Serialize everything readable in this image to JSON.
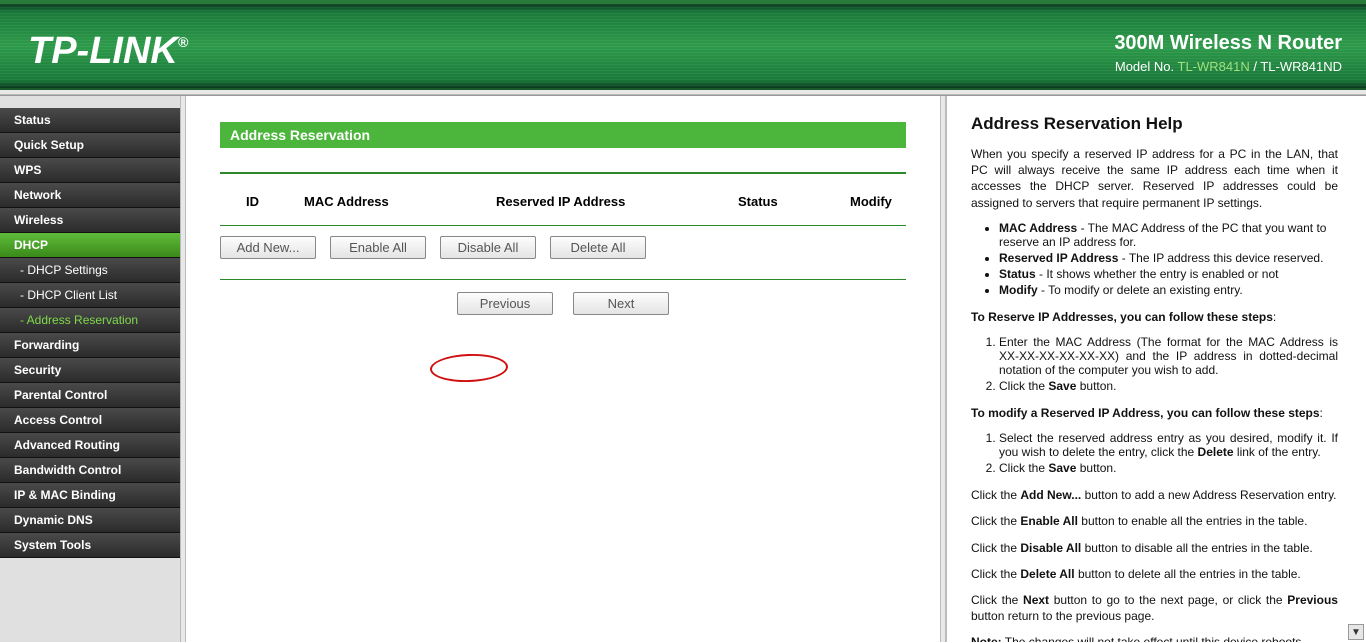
{
  "header": {
    "brand": "TP-LINK",
    "reg": "®",
    "product": "300M Wireless N Router",
    "model_prefix": "Model No. ",
    "model_hl": "TL-WR841N",
    "model_suffix": " / TL-WR841ND"
  },
  "sidebar": {
    "items": [
      {
        "label": "Status",
        "type": "top"
      },
      {
        "label": "Quick Setup",
        "type": "top"
      },
      {
        "label": "WPS",
        "type": "top"
      },
      {
        "label": "Network",
        "type": "top"
      },
      {
        "label": "Wireless",
        "type": "top"
      },
      {
        "label": "DHCP",
        "type": "section-active"
      },
      {
        "label": "- DHCP Settings",
        "type": "sub"
      },
      {
        "label": "- DHCP Client List",
        "type": "sub"
      },
      {
        "label": "- Address Reservation",
        "type": "sub active"
      },
      {
        "label": "Forwarding",
        "type": "top"
      },
      {
        "label": "Security",
        "type": "top"
      },
      {
        "label": "Parental Control",
        "type": "top"
      },
      {
        "label": "Access Control",
        "type": "top"
      },
      {
        "label": "Advanced Routing",
        "type": "top"
      },
      {
        "label": "Bandwidth Control",
        "type": "top"
      },
      {
        "label": "IP & MAC Binding",
        "type": "top"
      },
      {
        "label": "Dynamic DNS",
        "type": "top"
      },
      {
        "label": "System Tools",
        "type": "top"
      }
    ]
  },
  "main": {
    "title": "Address Reservation",
    "columns": {
      "id": "ID",
      "mac": "MAC Address",
      "ip": "Reserved IP Address",
      "status": "Status",
      "modify": "Modify"
    },
    "buttons": {
      "add": "Add New...",
      "enable": "Enable All",
      "disable": "Disable All",
      "delete": "Delete All"
    },
    "pager": {
      "prev": "Previous",
      "next": "Next"
    }
  },
  "help": {
    "title": "Address Reservation Help",
    "intro": "When you specify a reserved IP address for a PC in the LAN, that PC will always receive the same IP address each time when it accesses the DHCP server. Reserved IP addresses could be assigned to servers that require permanent IP settings.",
    "defs": {
      "mac_t": "MAC Address",
      "mac_d": " - The MAC Address of the PC that you want to reserve an IP address for.",
      "rip_t": "Reserved IP Address",
      "rip_d": " - The IP address this device reserved.",
      "st_t": "Status",
      "st_d": " - It shows whether the entry is enabled or not",
      "mod_t": "Modify",
      "mod_d": " - To modify or delete an existing entry."
    },
    "steps1_title": "To Reserve IP Addresses, you can follow these steps",
    "steps1": [
      "Enter the MAC Address (The format for the MAC Address is XX-XX-XX-XX-XX-XX) and the IP address in dotted-decimal notation of the computer you wish to add.",
      {
        "pre": "Click the ",
        "b": "Save",
        "post": " button."
      }
    ],
    "steps2_title": "To modify a Reserved IP Address, you can follow these steps",
    "steps2": [
      {
        "pre": "Select the reserved address entry as you desired, modify it. If you wish to delete the entry, click the ",
        "b": "Delete",
        "post": " link of the entry."
      },
      {
        "pre": "Click the ",
        "b": "Save",
        "post": " button."
      }
    ],
    "p_add": {
      "pre": "Click the ",
      "b": "Add New...",
      "post": " button to add a new Address Reservation entry."
    },
    "p_en": {
      "pre": "Click the ",
      "b": "Enable All",
      "post": " button to enable all the entries in the table."
    },
    "p_dis": {
      "pre": "Click the ",
      "b": "Disable All",
      "post": " button to disable all the entries in the table."
    },
    "p_del": {
      "pre": "Click the ",
      "b": "Delete All",
      "post": " button to delete all the entries in the table."
    },
    "p_nav": {
      "pre": "Click the ",
      "b1": "Next",
      "mid": " button to go to the next page, or click the ",
      "b2": "Previous",
      "post": " button return to the previous page."
    },
    "note": {
      "b": "Note:",
      "post": " The changes will not take effect until this device reboots"
    }
  }
}
